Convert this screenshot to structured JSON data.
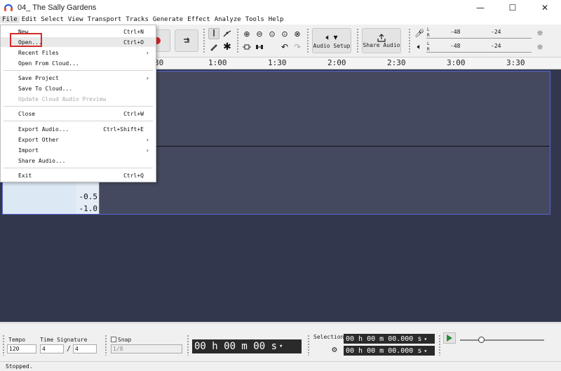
{
  "window": {
    "title": "04_ The Sally Gardens"
  },
  "menubar": {
    "items": [
      "File",
      "Edit",
      "Select",
      "View",
      "Transport",
      "Tracks",
      "Generate",
      "Effect",
      "Analyze",
      "Tools",
      "Help"
    ]
  },
  "toolbar": {
    "audio_setup_label": "Audio Setup",
    "share_audio_label": "Share Audio",
    "meter_ticks_top": [
      "-48",
      "-24"
    ],
    "meter_ticks_bottom": [
      "-48",
      "-24"
    ],
    "meter_lr": [
      "L",
      "R"
    ]
  },
  "ruler": {
    "ticks": [
      "30",
      "1:00",
      "1:30",
      "2:00",
      "2:30",
      "3:00",
      "3:30"
    ]
  },
  "track": {
    "scale_labels": [
      "-0.5",
      "-1.0"
    ]
  },
  "file_menu": {
    "items": [
      {
        "label": "New",
        "shortcut": "Ctrl+N"
      },
      {
        "label": "Open...",
        "shortcut": "Ctrl+O"
      },
      {
        "label": "Recent Files",
        "shortcut": ""
      },
      {
        "label": "Open From Cloud...",
        "shortcut": ""
      },
      {
        "label": "Save Project",
        "shortcut": ""
      },
      {
        "label": "Save To Cloud...",
        "shortcut": ""
      },
      {
        "label": "Update Cloud Audio Preview",
        "shortcut": ""
      },
      {
        "label": "Close",
        "shortcut": "Ctrl+W"
      },
      {
        "label": "Export Audio...",
        "shortcut": "Ctrl+Shift+E"
      },
      {
        "label": "Export Other",
        "shortcut": ""
      },
      {
        "label": "Import",
        "shortcut": ""
      },
      {
        "label": "Share Audio...",
        "shortcut": ""
      },
      {
        "label": "Exit",
        "shortcut": "Ctrl+Q"
      }
    ]
  },
  "bottom": {
    "tempo_label": "Tempo",
    "tempo_value": "120",
    "time_sig_label": "Time Signature",
    "time_sig_num": "4",
    "time_sig_slash": "/",
    "time_sig_den": "4",
    "snap_label": "Snap",
    "snap_value": "1/8",
    "time_display": "00 h 00 m 00 s",
    "selection_label": "Selection",
    "selection_start": "00 h 00 m 00.000 s",
    "selection_end": "00 h 00 m 00.000 s",
    "playback_slider_fraction": 0.25
  },
  "status": {
    "text": "Stopped."
  },
  "colors": {
    "track_bg": "#33374d",
    "wave_bg": "#45495f",
    "highlight": "#d42a2a",
    "track_border": "#5566cc"
  }
}
